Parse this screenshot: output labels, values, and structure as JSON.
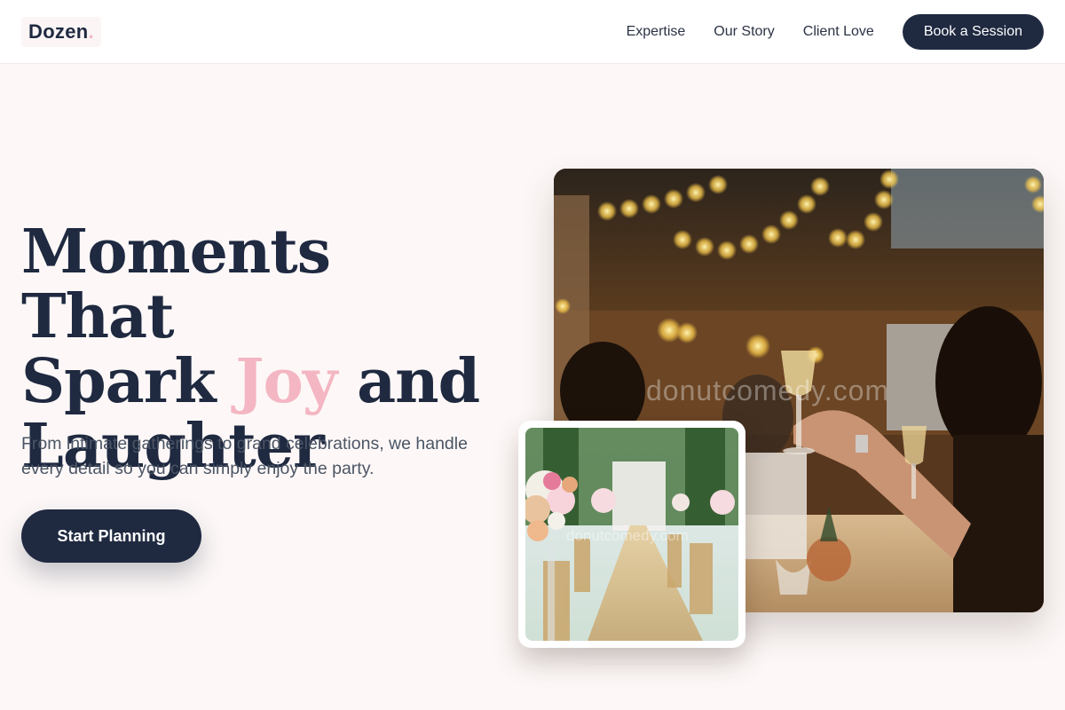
{
  "header": {
    "logo_text": "Dozen",
    "logo_dot": ".",
    "nav": [
      {
        "label": "Expertise"
      },
      {
        "label": "Our Story"
      },
      {
        "label": "Client Love"
      }
    ],
    "cta_label": "Book a Session"
  },
  "hero": {
    "title_line1": "Moments That",
    "title_line2_before": "Spark ",
    "title_accent": "Joy",
    "title_line2_after": " and",
    "title_line3": "Laughter",
    "subtitle": "From intimate gatherings to grand celebrations, we handle every detail so you can simply enjoy the party.",
    "cta_label": "Start Planning"
  },
  "images": {
    "main_watermark": "donutcomedy.com",
    "card_watermark": "donutcomedy.com"
  },
  "colors": {
    "brand_navy": "#1f2940",
    "accent_pink": "#f4b6c2",
    "page_bg": "#fdf8f7"
  }
}
